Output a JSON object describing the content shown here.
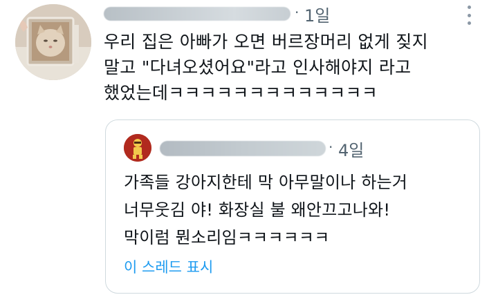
{
  "tweet": {
    "time_separator": "·",
    "time": "1일",
    "text": "우리 집은 아빠가 오면 버르장머리 없게 짖지\n말고 \"다녀오셨어요\"라고 인사해야지 라고\n했었는데ㅋㅋㅋㅋㅋㅋㅋㅋㅋㅋㅋㅋㅋ"
  },
  "quoted_tweet": {
    "time_separator": "·",
    "time": "4일",
    "text": "가족들 강아지한테 막 아무말이나 하는거\n너무웃김 야! 화장실 불 왜안끄고나와!\n막이럼 뭔소리임ㅋㅋㅋㅋㅋㅋ",
    "show_thread_label": "이 스레드 표시"
  },
  "colors": {
    "text": "#0f1419",
    "muted": "#536471",
    "link": "#1d9bf0",
    "border": "#cfd9de"
  },
  "icons": {
    "more": "more-vertical-icon"
  }
}
